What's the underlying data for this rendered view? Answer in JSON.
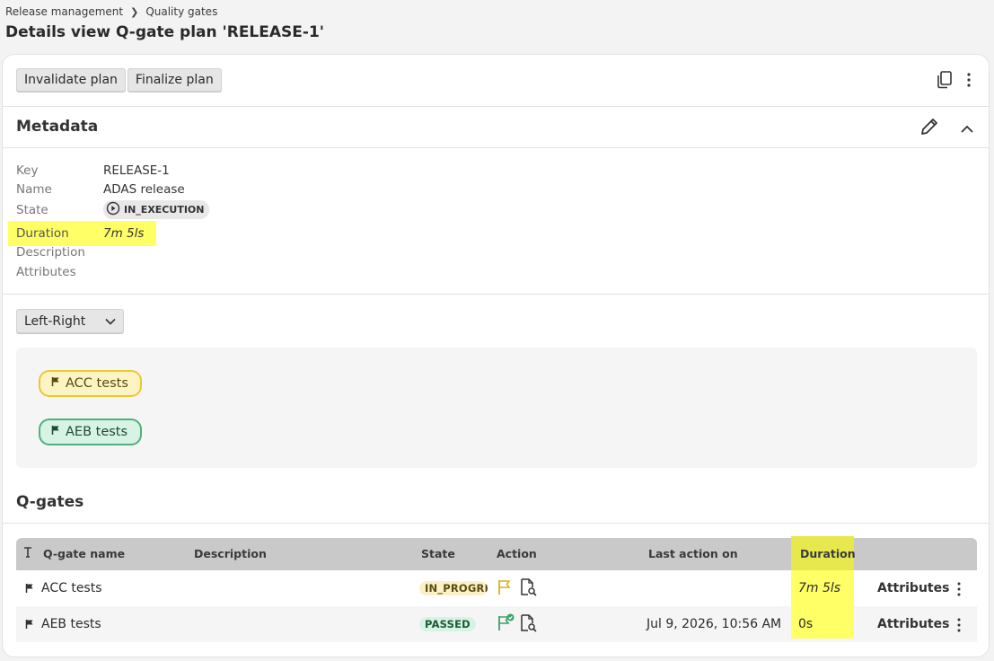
{
  "breadcrumb": {
    "parent": "Release management",
    "current": "Quality gates"
  },
  "page_title": "Details view Q-gate plan 'RELEASE-1'",
  "toolbar": {
    "invalidate_label": "Invalidate plan",
    "finalize_label": "Finalize plan",
    "icons": [
      "copy-icon",
      "more-vert-icon"
    ]
  },
  "metadata": {
    "title": "Metadata",
    "fields": [
      {
        "key": "Key",
        "value": "RELEASE-1"
      },
      {
        "key": "Name",
        "value": "ADAS release"
      },
      {
        "key": "State",
        "value": "IN_EXECUTION"
      },
      {
        "key": "Duration",
        "value": "7m 5ls"
      },
      {
        "key": "Description",
        "value": ""
      },
      {
        "key": "Attributes",
        "value": ""
      }
    ],
    "highlight_color": "#ffff66"
  },
  "layout_selector": {
    "value": "Left-Right"
  },
  "flow": {
    "nodes": [
      {
        "label": "ACC tests",
        "status": "in_progress",
        "color": "#ecc633"
      },
      {
        "label": "AEB tests",
        "status": "passed",
        "color": "#4fb07c"
      }
    ]
  },
  "qgates": {
    "title": "Q-gates",
    "columns": [
      "Q-gate name",
      "Description",
      "State",
      "Action",
      "Last action on",
      "Duration"
    ],
    "rows": [
      {
        "name": "ACC tests",
        "description": "",
        "state": "IN_PROGRESS",
        "last_action": "",
        "duration": "7m 5ls",
        "attributes": "Attributes"
      },
      {
        "name": "AEB tests",
        "description": "",
        "state": "PASSED",
        "last_action": "Jul 9, 2026, 10:56 AM",
        "duration": "0s",
        "attributes": "Attributes"
      }
    ]
  }
}
